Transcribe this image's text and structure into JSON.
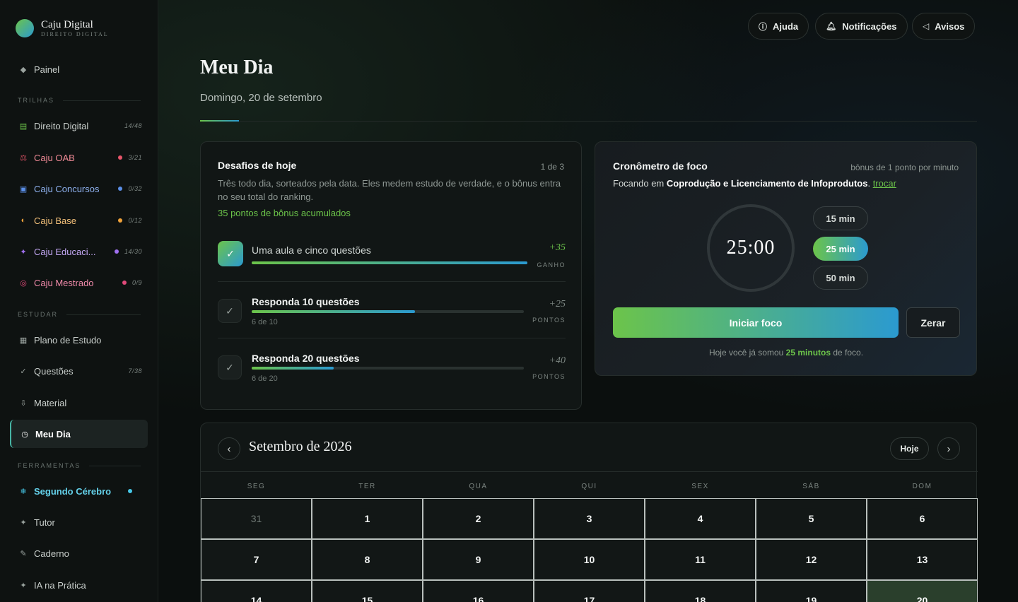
{
  "brand": {
    "name": "Caju Digital",
    "subtitle": "DIREITO DIGITAL"
  },
  "sidebar": {
    "top": {
      "label": "Painel",
      "icon": "diamond-icon"
    },
    "sections": {
      "trilhas": "TRILHAS",
      "estudar": "ESTUDAR",
      "ferramentas": "FERRAMENTAS"
    },
    "trilhas": [
      {
        "label": "Direito Digital",
        "count": "14/48",
        "icon": "book-icon",
        "icon_color": "#6cc44a",
        "dot": ""
      },
      {
        "label": "Caju OAB",
        "count": "3/21",
        "icon": "scale-icon",
        "icon_color": "#e8556a",
        "dot": "#e8556a"
      },
      {
        "label": "Caju Concursos",
        "count": "0/32",
        "icon": "square-icon",
        "icon_color": "#5b8fe8",
        "dot": "#5b8fe8"
      },
      {
        "label": "Caju Base",
        "count": "0/12",
        "icon": "half-circle-icon",
        "icon_color": "#f0a23a",
        "dot": "#f0a23a"
      },
      {
        "label": "Caju Educaci...",
        "count": "14/30",
        "icon": "sparkle-icon",
        "icon_color": "#a070f0",
        "dot": "#a070f0"
      },
      {
        "label": "Caju Mestrado",
        "count": "0/9",
        "icon": "target-icon",
        "icon_color": "#e04a7a",
        "dot": "#e04a7a"
      }
    ],
    "estudar": [
      {
        "label": "Plano de Estudo",
        "count": "",
        "icon": "grid-icon"
      },
      {
        "label": "Questões",
        "count": "7/38",
        "icon": "check-icon"
      },
      {
        "label": "Material",
        "count": "",
        "icon": "download-icon"
      },
      {
        "label": "Meu Dia",
        "count": "",
        "icon": "clock-icon",
        "active": true
      }
    ],
    "ferramentas": [
      {
        "label": "Segundo Cérebro",
        "icon": "snowflake-icon",
        "dot": "#46c8e8"
      },
      {
        "label": "Tutor",
        "icon": "star-icon"
      },
      {
        "label": "Caderno",
        "icon": "pencil-icon"
      },
      {
        "label": "IA na Prática",
        "icon": "sparkle-icon"
      }
    ]
  },
  "topbar": {
    "help": "Ajuda",
    "notifications": "Notificações",
    "notices": "Avisos"
  },
  "page": {
    "title": "Meu Dia",
    "date": "Domingo, 20 de setembro"
  },
  "challenges": {
    "title": "Desafios de hoje",
    "count": "1 de 3",
    "description": "Três todo dia, sorteados pela data. Eles medem estudo de verdade, e o bônus entra no seu total do ranking.",
    "bonus": "35 pontos de bônus acumulados",
    "items": [
      {
        "name": "Uma aula e cinco questões",
        "progress_text": "",
        "progress": 1.0,
        "points": "+35",
        "points_label": "GANHO",
        "done": true
      },
      {
        "name": "Responda 10 questões",
        "progress_text": "6 de 10",
        "progress": 0.6,
        "points": "+25",
        "points_label": "PONTOS",
        "done": false
      },
      {
        "name": "Responda 20 questões",
        "progress_text": "6 de 20",
        "progress": 0.3,
        "points": "+40",
        "points_label": "PONTOS",
        "done": false
      }
    ]
  },
  "focus": {
    "title": "Cronômetro de foco",
    "bonus": "bônus de 1 ponto por minuto",
    "focusing_prefix": "Focando em ",
    "topic": "Coprodução e Licenciamento de Infoprodutos",
    "change_link": "trocar",
    "time": "25:00",
    "durations": [
      "15 min",
      "25 min",
      "50 min"
    ],
    "selected_duration": "25 min",
    "start": "Iniciar foco",
    "reset": "Zerar",
    "today_prefix": "Hoje você já somou ",
    "today_value": "25 minutos",
    "today_suffix": " de foco."
  },
  "calendar": {
    "month": "Setembro de 2026",
    "today_button": "Hoje",
    "weekdays": [
      "SEG",
      "TER",
      "QUA",
      "QUI",
      "SEX",
      "SÁB",
      "DOM"
    ],
    "weeks": [
      [
        "31",
        "1",
        "2",
        "3",
        "4",
        "5",
        "6"
      ],
      [
        "7",
        "8",
        "9",
        "10",
        "11",
        "12",
        "13"
      ],
      [
        "14",
        "15",
        "16",
        "17",
        "18",
        "19",
        "20"
      ]
    ],
    "muted_days": [
      "31"
    ],
    "today": "20"
  }
}
